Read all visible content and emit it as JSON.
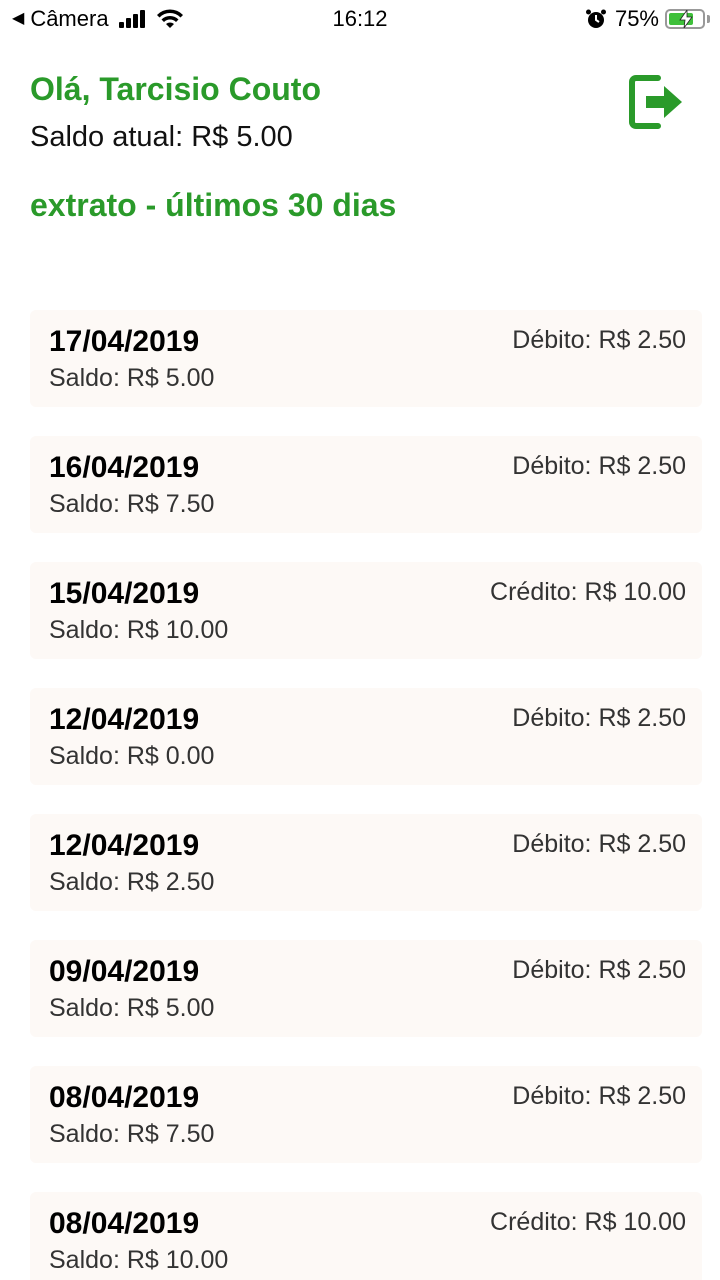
{
  "status_bar": {
    "back_app": "Câmera",
    "time": "16:12",
    "battery_percent": "75%",
    "battery_level": 0.75
  },
  "header": {
    "greeting": "Olá, Tarcisio Couto",
    "balance": "Saldo atual: R$ 5.00",
    "logout_icon": "logout-icon",
    "section_title": "extrato - últimos 30 dias"
  },
  "colors": {
    "accent_green": "#2a9a2a",
    "card_bg": "#fdf9f6"
  },
  "transactions": [
    {
      "date": "17/04/2019",
      "saldo": "Saldo: R$ 5.00",
      "amount": "Débito: R$ 2.50"
    },
    {
      "date": "16/04/2019",
      "saldo": "Saldo: R$ 7.50",
      "amount": "Débito: R$ 2.50"
    },
    {
      "date": "15/04/2019",
      "saldo": "Saldo: R$ 10.00",
      "amount": "Crédito: R$ 10.00"
    },
    {
      "date": "12/04/2019",
      "saldo": "Saldo: R$ 0.00",
      "amount": "Débito: R$ 2.50"
    },
    {
      "date": "12/04/2019",
      "saldo": "Saldo: R$ 2.50",
      "amount": "Débito: R$ 2.50"
    },
    {
      "date": "09/04/2019",
      "saldo": "Saldo: R$ 5.00",
      "amount": "Débito: R$ 2.50"
    },
    {
      "date": "08/04/2019",
      "saldo": "Saldo: R$ 7.50",
      "amount": "Débito: R$ 2.50"
    },
    {
      "date": "08/04/2019",
      "saldo": "Saldo: R$ 10.00",
      "amount": "Crédito: R$ 10.00"
    }
  ]
}
